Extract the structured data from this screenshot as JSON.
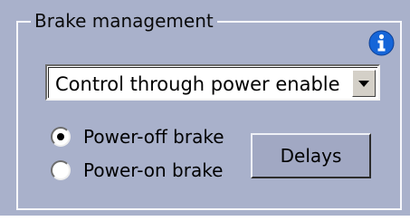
{
  "brake_management": {
    "title": "Brake management",
    "info_icon": "info-icon",
    "mode_select": {
      "value": "Control through power enable"
    },
    "radio_options": [
      {
        "label": "Power-off brake",
        "checked": true
      },
      {
        "label": "Power-on brake",
        "checked": false
      }
    ],
    "delays_button_label": "Delays"
  },
  "colors": {
    "panel_background": "#a9b1cb",
    "info_icon": "#1565d8",
    "button_face": "#a1a8c3"
  }
}
